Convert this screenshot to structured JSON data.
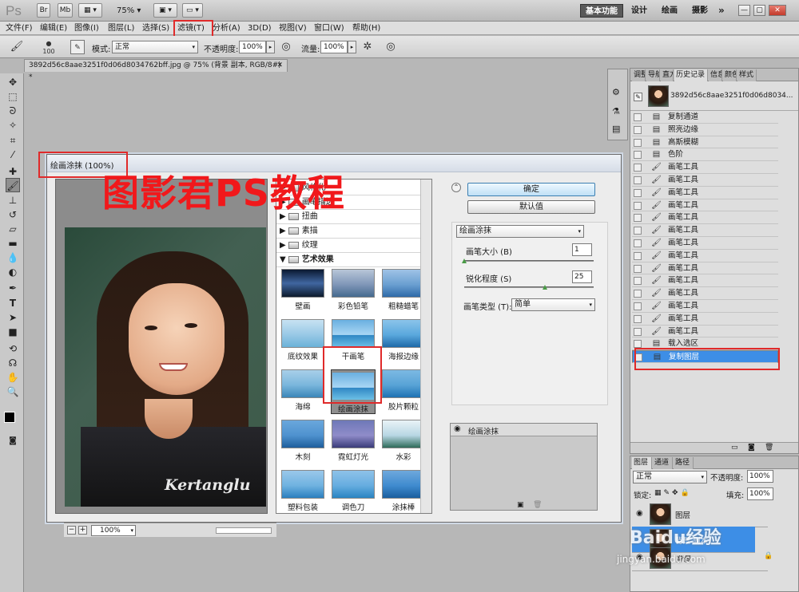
{
  "app": {
    "logo": "Ps",
    "bridge_btn": "Br",
    "minibridge_btn": "Mb",
    "zoom_level": "75%",
    "workspaces": [
      "基本功能",
      "设计",
      "绘画",
      "摄影",
      "»"
    ],
    "window_controls": [
      "—",
      "▢",
      "✕"
    ]
  },
  "menu": [
    "文件(F)",
    "编辑(E)",
    "图像(I)",
    "图层(L)",
    "选择(S)",
    "滤镜(T)",
    "分析(A)",
    "3D(D)",
    "视图(V)",
    "窗口(W)",
    "帮助(H)"
  ],
  "options": {
    "brush_size": "100",
    "mode_label": "模式:",
    "mode_value": "正常",
    "opacity_label": "不透明度:",
    "opacity_value": "100%",
    "flow_label": "流量:",
    "flow_value": "100%"
  },
  "document_tab": "3892d56c8aae3251f0d06d8034762bff.jpg @ 75% (背景 副本, RGB/8#) *",
  "dialog": {
    "title": "绘画涂抹 (100%)",
    "zoom_value": "100%",
    "zoom_minus": "−",
    "zoom_plus": "+",
    "photo_text": "Kertanglu",
    "categories": [
      "风格化",
      "画笔描边",
      "扭曲",
      "素描",
      "纹理",
      "艺术效果"
    ],
    "filters": [
      "壁画",
      "彩色铅笔",
      "粗糙蜡笔",
      "底纹效果",
      "干画笔",
      "海报边缘",
      "海绵",
      "绘画涂抹",
      "胶片颗粒",
      "木刻",
      "霓虹灯光",
      "水彩",
      "塑料包装",
      "调色刀",
      "涂抹棒"
    ],
    "selected_filter": "绘画涂抹",
    "ok_button": "确定",
    "default_button": "默认值",
    "filter_select": "绘画涂抹",
    "params": {
      "brush_size_label": "画笔大小 (B)",
      "brush_size_value": "1",
      "brush_size_level": 0,
      "sharpness_label": "锐化程度 (S)",
      "sharpness_value": "25",
      "sharpness_level": 0.625,
      "brush_type_label": "画笔类型 (T):",
      "brush_type_value": "简单"
    },
    "effect_layer": "绘画涂抹"
  },
  "watermark": "图影君PS教程",
  "history": {
    "tabs": [
      "调整",
      "导航",
      "直方图",
      "历史记录",
      "信息",
      "颜色",
      "样式"
    ],
    "active_tab": "历史记录",
    "snapshot_name": "3892d56c8aae3251f0d06d8034...",
    "items": [
      "复制通道",
      "照亮边缘",
      "高斯模糊",
      "色阶",
      "画笔工具",
      "画笔工具",
      "画笔工具",
      "画笔工具",
      "画笔工具",
      "画笔工具",
      "画笔工具",
      "画笔工具",
      "画笔工具",
      "画笔工具",
      "画笔工具",
      "画笔工具",
      "画笔工具",
      "画笔工具",
      "载入选区",
      "复制图层"
    ],
    "selected": "复制图层"
  },
  "layers": {
    "tabs": [
      "图层",
      "通道",
      "路径"
    ],
    "blend_mode": "正常",
    "opacity_label": "不透明度:",
    "opacity_value": "100%",
    "lock_label": "锁定:",
    "fill_label": "填充:",
    "fill_value": "100%",
    "rows": [
      "图层",
      "背景 副本",
      "背景"
    ]
  },
  "site_watermark": {
    "brand": "Baidu经验",
    "url": "jingyan.baidu.com"
  },
  "colors": {
    "highlight_red": "#e02a2a",
    "selection_blue": "#3d8ee6",
    "watermark_red": "#f1181b"
  }
}
